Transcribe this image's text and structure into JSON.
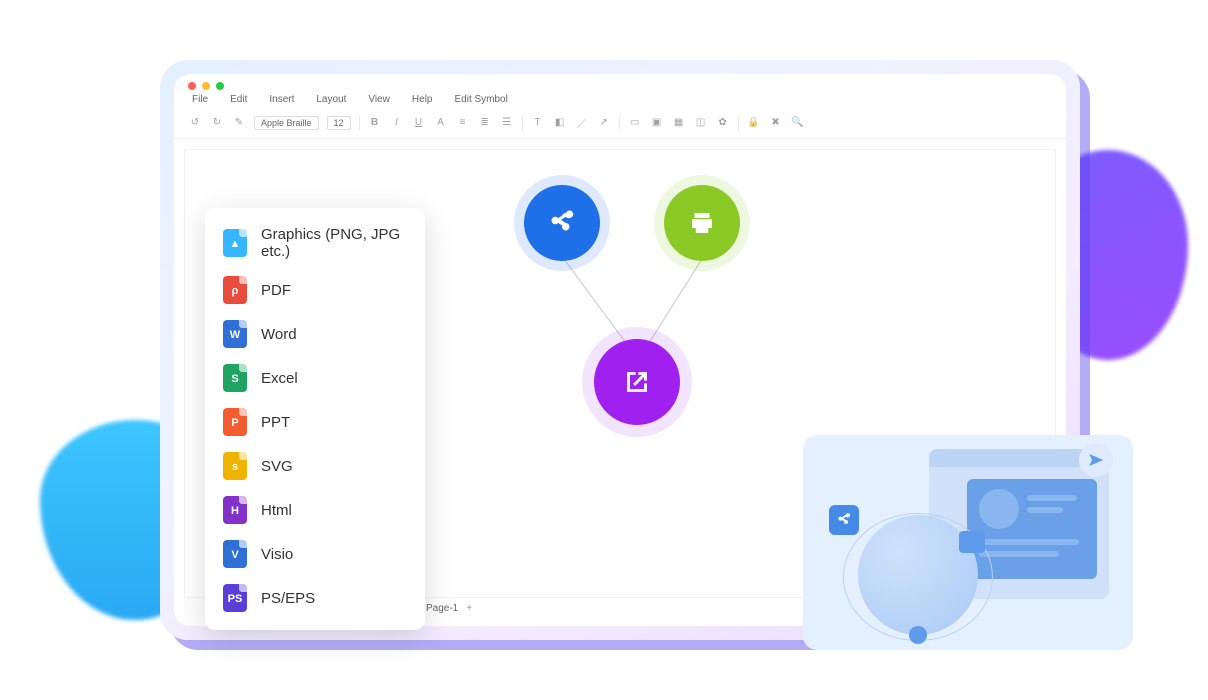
{
  "menu": [
    "File",
    "Edit",
    "Insert",
    "Layout",
    "View",
    "Help",
    "Edit Symbol"
  ],
  "font": {
    "family": "Apple Braille",
    "size": "12"
  },
  "page_tab": "Page-1",
  "export_options": [
    {
      "label": "Graphics (PNG, JPG etc.)",
      "mark": "▲",
      "color": "#36b6ff"
    },
    {
      "label": "PDF",
      "mark": "ρ",
      "color": "#e74c3c"
    },
    {
      "label": "Word",
      "mark": "W",
      "color": "#2f6fd6"
    },
    {
      "label": "Excel",
      "mark": "S",
      "color": "#1fa463"
    },
    {
      "label": "PPT",
      "mark": "P",
      "color": "#f25c2e"
    },
    {
      "label": "SVG",
      "mark": "s",
      "color": "#f0b400"
    },
    {
      "label": "Html",
      "mark": "H",
      "color": "#8431c9"
    },
    {
      "label": "Visio",
      "mark": "V",
      "color": "#2f6fd6"
    },
    {
      "label": "PS/EPS",
      "mark": "PS",
      "color": "#5a3fd6"
    }
  ]
}
